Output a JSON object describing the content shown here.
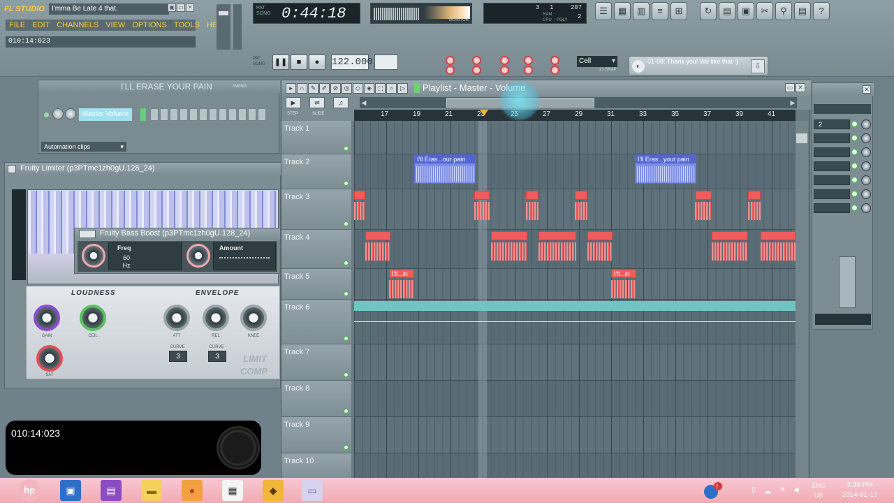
{
  "app": {
    "logo": "FL STUDIO",
    "song_title": "I'mma Be Late 4 that.",
    "menu": [
      "FILE",
      "EDIT",
      "CHANNELS",
      "VIEW",
      "OPTIONS",
      "TOOLS",
      "HELP"
    ],
    "hint_time": "010:14:023",
    "window_buttons": [
      "▣",
      "▭",
      "✕"
    ]
  },
  "transport": {
    "time_display": "0:44:18",
    "time_labels": "PAT SONG",
    "tempo": "122.000",
    "tempo_label": "TEMPO",
    "pattern_label": "PAT",
    "pat_song": "PAT SONG"
  },
  "monitor": {
    "label": "MONITOR"
  },
  "cpu": {
    "value1": "3",
    "value2": "1",
    "value3": "207",
    "value4": "2",
    "label_ram": "RAM",
    "label_cpu": "CPU",
    "label_poly": "POLY"
  },
  "snap": {
    "value": "Cell",
    "sub": "21 SNAP"
  },
  "notice": {
    "text": "01-08: Thank you! We like that :)"
  },
  "channel_rack": {
    "title": "I'LL ERASE YOUR PAIN",
    "swing_label": "SWING",
    "channel_name": "Master Volume",
    "dropdown": "Automation clips"
  },
  "limiter": {
    "title": "Fruity Limiter (p3PTmc1zh0gU.128_24)",
    "loudness_label": "LOUDNESS",
    "envelope_label": "ENVELOPE",
    "gain_label": "GAIN",
    "ceil_label": "CEIL",
    "sat_label": "SAT",
    "att_label": "ATT",
    "rel_label": "REL",
    "knee_label": "KNEE",
    "curve_label": "CURVE",
    "curve1": "3",
    "curve2": "3",
    "limit_label": "LIMIT",
    "comp_label": "COMP"
  },
  "bassboost": {
    "title": "Fruity Bass Boost (p3PTmc1zh0gU.128_24)",
    "freq_label": "Freq",
    "freq_value": "60",
    "freq_unit": "Hz",
    "amount_label": "Amount"
  },
  "playlist": {
    "title": "Playlist - Master - Volume",
    "step_label": "STEP",
    "slide_label": "SLIDE",
    "ruler": [
      "17",
      "19",
      "21",
      "23",
      "25",
      "27",
      "29",
      "31",
      "33",
      "35",
      "37",
      "39",
      "41"
    ],
    "tracks": [
      "Track 1",
      "Track 2",
      "Track 3",
      "Track 4",
      "Track 5",
      "Track 6",
      "Track 7",
      "Track 8",
      "Track 9",
      "Track 10"
    ],
    "clip_blue_label": "I'll Eras...our pain",
    "clip_blue_label2": "I'll Eras...your pain",
    "clip_red_label": "I'll...in"
  },
  "mixer": {
    "rows": [
      "2",
      "",
      "",
      "",
      "",
      "",
      ""
    ]
  },
  "overlay": {
    "time": "010:14:023"
  },
  "taskbar": {
    "start_label": "hp",
    "lang_top": "ENG",
    "lang_bottom": "US",
    "time": "2:35 PM",
    "date": "2014-01-17"
  }
}
